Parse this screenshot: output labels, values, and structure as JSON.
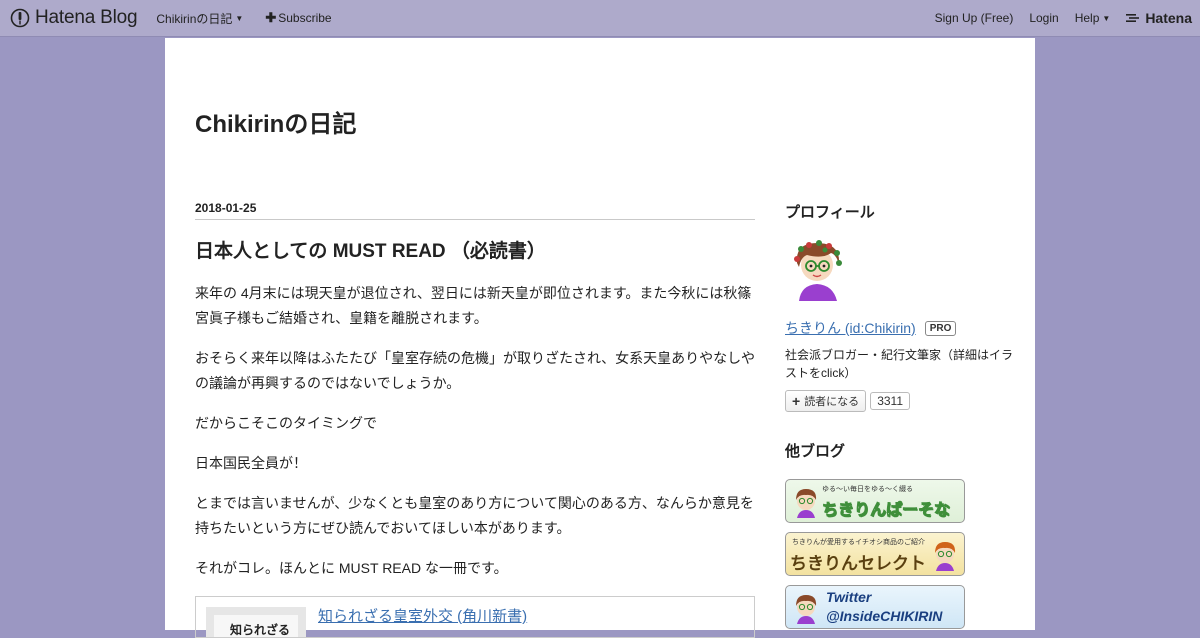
{
  "topbar": {
    "brand": "Hatena Blog",
    "blog_menu": "Chikirinの日記",
    "subscribe": "Subscribe",
    "signup": "Sign Up (Free)",
    "login": "Login",
    "help": "Help",
    "hatena": "Hatena"
  },
  "blog": {
    "title": "Chikirinの日記"
  },
  "entry": {
    "date": "2018-01-25",
    "title": "日本人としての MUST READ （必読書）",
    "paragraphs": [
      "来年の 4月末には現天皇が退位され、翌日には新天皇が即位されます。また今秋には秋篠宮眞子様もご結婚され、皇籍を離脱されます。",
      "おそらく来年以降はふたたび「皇室存続の危機」が取りざたされ、女系天皇ありやなしやの議論が再興するのではないでしょうか。",
      "だからこそこのタイミングで",
      "日本国民全員が！",
      "とまでは言いませんが、少なくとも皇室のあり方について関心のある方、なんらか意見を持ちたいという方にぜひ読んでおいてほしい本があります。",
      "それがコレ。ほんとに MUST READ な一冊です。"
    ],
    "book": {
      "cover_text": "知られざる",
      "title": "知られざる皇室外交 (角川新書)"
    }
  },
  "sidebar": {
    "profile_heading": "プロフィール",
    "profile_name": "ちきりん (id:Chikirin)",
    "pro_badge": "PRO",
    "profile_desc": "社会派ブロガー・紀行文筆家（詳細はイラストをclick）",
    "subscribe_label": "読者になる",
    "subscriber_count": "3311",
    "other_blogs_heading": "他ブログ",
    "banners": [
      {
        "small": "ゆる〜い毎日をゆる〜く綴る",
        "title": "ちきりんぱーそなる",
        "color": "#6fc06a"
      },
      {
        "small": "ちきりんが愛用するイチオシ商品のご紹介",
        "title": "ちきりんセレクト",
        "color": "#c9a22f"
      },
      {
        "small": "",
        "title": "Twitter @InsideCHIKIRIN",
        "title_line1": "Twitter",
        "title_line2": "@InsideCHIKIRIN",
        "color": "#55a8dd"
      }
    ]
  },
  "colors": {
    "background": "#9b97c2",
    "topbar": "#aeaacb",
    "link": "#3a6fb0"
  }
}
